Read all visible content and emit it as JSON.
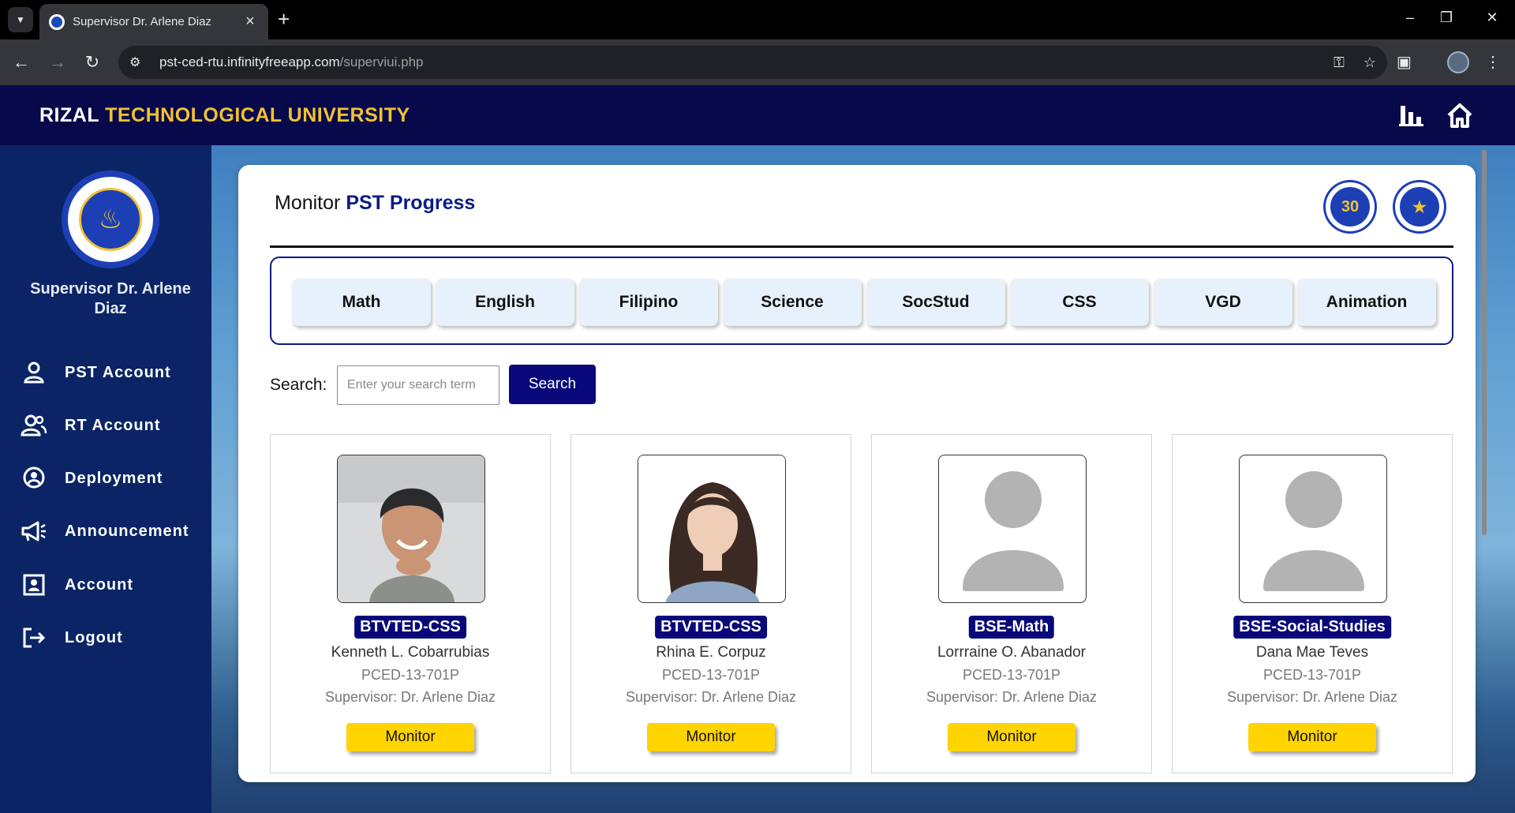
{
  "browser": {
    "tab_title": "Supervisor Dr. Arlene Diaz",
    "url_host": "pst-ced-rtu.infinityfreeapp.com",
    "url_path": "/superviui.php"
  },
  "header": {
    "brand_first": "RIZAL",
    "brand_rest": "TECHNOLOGICAL UNIVERSITY",
    "icons": [
      "bar-chart-icon",
      "home-icon"
    ]
  },
  "sidebar": {
    "supervisor_name": "Supervisor Dr. Arlene Diaz",
    "items": [
      {
        "label": "PST Account",
        "icon": "person-icon"
      },
      {
        "label": "RT Account",
        "icon": "users-icon"
      },
      {
        "label": "Deployment",
        "icon": "location-pin-icon"
      },
      {
        "label": "Announcement",
        "icon": "megaphone-icon"
      },
      {
        "label": "Account",
        "icon": "id-card-icon"
      },
      {
        "label": "Logout",
        "icon": "logout-icon"
      }
    ]
  },
  "main": {
    "title_plain": "Monitor",
    "title_bold": "PST Progress",
    "subjects": [
      "Math",
      "English",
      "Filipino",
      "Science",
      "SocStud",
      "CSS",
      "VGD",
      "Animation"
    ],
    "search": {
      "label": "Search:",
      "placeholder": "Enter your search term",
      "button": "Search"
    },
    "cards": [
      {
        "program": "BTVTED-CSS",
        "name": "Kenneth L. Cobarrubias",
        "code": "PCED-13-701P",
        "supervisor": "Supervisor: Dr. Arlene Diaz",
        "button": "Monitor",
        "photo": "male-student-photo"
      },
      {
        "program": "BTVTED-CSS",
        "name": "Rhina E. Corpuz",
        "code": "PCED-13-701P",
        "supervisor": "Supervisor: Dr. Arlene Diaz",
        "button": "Monitor",
        "photo": "female-student-photo"
      },
      {
        "program": "BSE-Math",
        "name": "Lorrraine O. Abanador",
        "code": "PCED-13-701P",
        "supervisor": "Supervisor: Dr. Arlene Diaz",
        "button": "Monitor",
        "photo": "avatar-placeholder"
      },
      {
        "program": "BSE-Social-Studies",
        "name": "Dana Mae Teves",
        "code": "PCED-13-701P",
        "supervisor": "Supervisor: Dr. Arlene Diaz",
        "button": "Monitor",
        "photo": "avatar-placeholder"
      }
    ]
  },
  "colors": {
    "header_bg": "#08094a",
    "sidebar_bg": "#0b2465",
    "brand_accent": "#f1c232",
    "primary_button": "#08087a",
    "monitor_button": "#ffd400",
    "subject_button_bg": "#e6f1fb"
  }
}
